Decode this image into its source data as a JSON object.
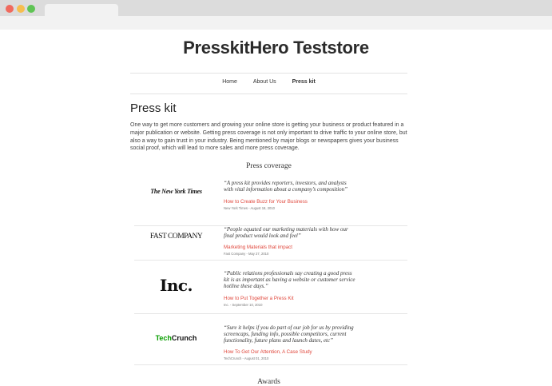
{
  "browser": {
    "controls": [
      "close",
      "minimize",
      "maximize"
    ]
  },
  "store": {
    "title": "PresskitHero Teststore"
  },
  "nav": {
    "items": [
      "Home",
      "About Us",
      "Press kit"
    ],
    "active": "Press kit"
  },
  "page": {
    "title": "Press kit",
    "intro": "One way to get more customers and growing your online store is getting your business or product featured in a major publication or website. Getting press coverage is not only important to drive traffic to your online store, but also a way to gain trust in your industry. Being mentioned by major blogs or newspapers gives your business social proof, which will lead to more sales and more press coverage."
  },
  "coverage": {
    "heading": "Press coverage",
    "items": [
      {
        "logo_text": "The New York Times",
        "quote": "“A press kit provides reporters, investors, and analysts with vital information about a company’s composition”",
        "link": "How to Create Buzz for Your Business",
        "meta": "New York Times - August 18, 2010"
      },
      {
        "logo_text": "FAST COMPANY",
        "quote": "“People equated our marketing materials with how our final product would look and feel”",
        "link": "Marketing Materials that impact",
        "meta": "Fast Company - May 27, 2010"
      },
      {
        "logo_text": "Inc.",
        "quote": "“Public relations professionals say creating a good press kit is as important as having a website or customer service hotline these days.”",
        "link": "How to Put Together a Press Kit",
        "meta": "Inc. - September 10, 2010"
      },
      {
        "logo_text_a": "Tech",
        "logo_text_b": "Crunch",
        "quote": "“Sure it helps if you do part of our job for us by providing screencaps, funding info, possible competitors, current functionality, future plans and launch dates, etc”",
        "link": "How To Get Our Attention, A Case Study",
        "meta": "TechCrunch - August 01, 2010"
      }
    ]
  },
  "awards": {
    "heading": "Awards"
  },
  "colors": {
    "link": "#e0483d",
    "techcrunch_green": "#0a9e01"
  }
}
